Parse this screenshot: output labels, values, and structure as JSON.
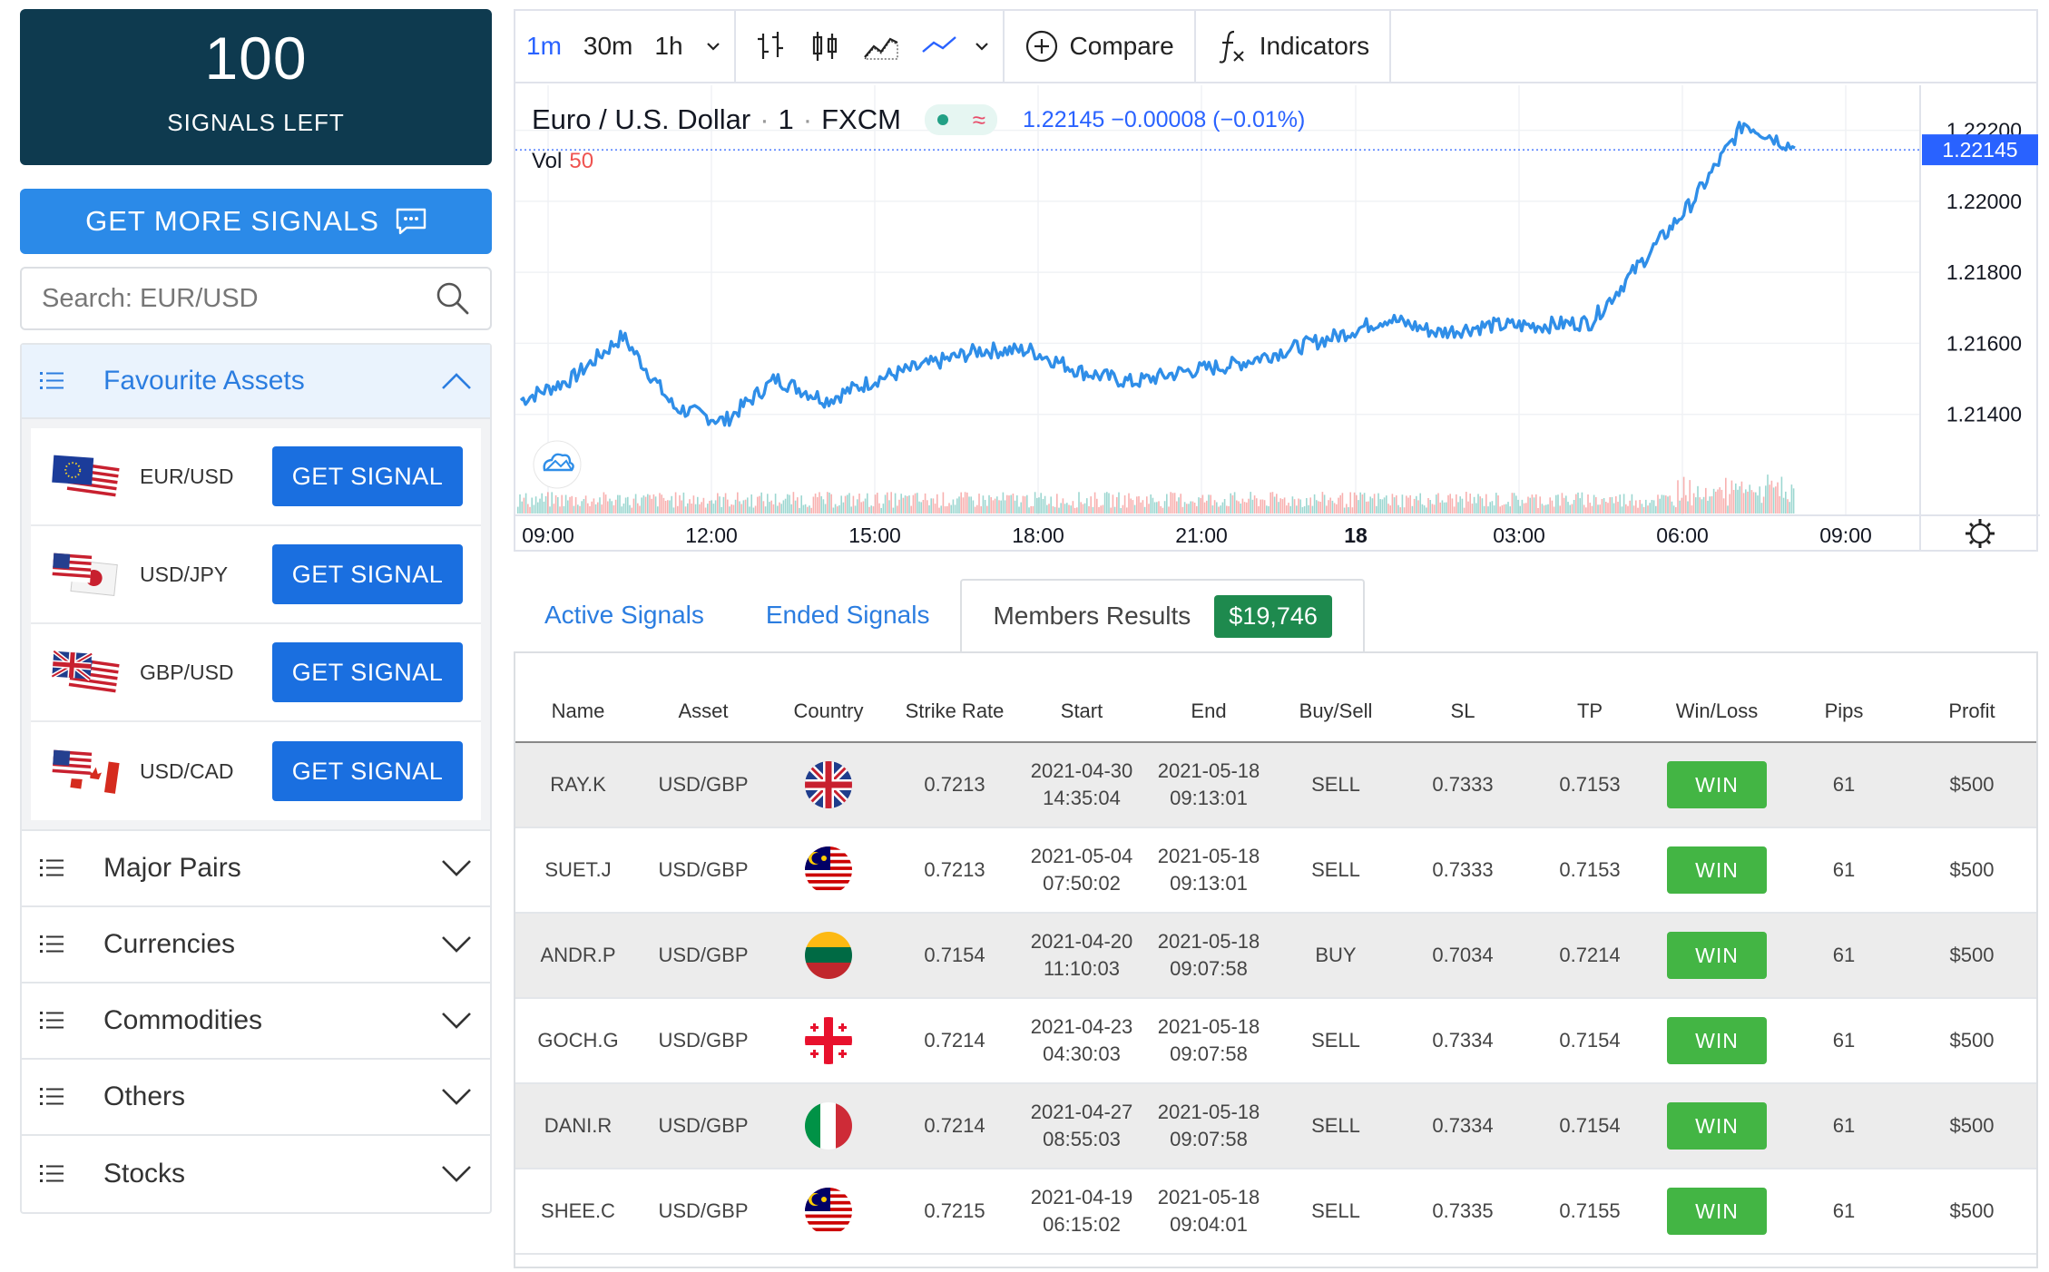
{
  "sidebar": {
    "signals_count": "100",
    "signals_label": "SIGNALS LEFT",
    "more_button": "GET MORE SIGNALS",
    "search_placeholder": "Search: EUR/USD",
    "favourite_title": "Favourite Assets",
    "favourites": [
      {
        "pair": "EUR/USD",
        "button": "GET SIGNAL"
      },
      {
        "pair": "USD/JPY",
        "button": "GET SIGNAL"
      },
      {
        "pair": "GBP/USD",
        "button": "GET SIGNAL"
      },
      {
        "pair": "USD/CAD",
        "button": "GET SIGNAL"
      }
    ],
    "categories": [
      "Major Pairs",
      "Currencies",
      "Commodities",
      "Others",
      "Stocks"
    ]
  },
  "chart": {
    "timeframes": [
      "1m",
      "30m",
      "1h"
    ],
    "active_timeframe": "1m",
    "compare_label": "Compare",
    "indicators_label": "Indicators",
    "symbol": "Euro / U.S. Dollar",
    "interval": "1",
    "exchange": "FXCM",
    "price_info": "1.22145  −0.00008 (−0.01%)",
    "vol_label": "Vol",
    "vol_value": "50",
    "current_price": "1.22145",
    "price_ticks": [
      "1.22200",
      "1.22000",
      "1.21800",
      "1.21600",
      "1.21400"
    ],
    "time_ticks": [
      "09:00",
      "12:00",
      "15:00",
      "18:00",
      "21:00",
      "18",
      "03:00",
      "06:00",
      "09:00"
    ],
    "colors": {
      "line": "#2f8ee8",
      "vol_up": "#26a69a",
      "vol_down": "#ef5350",
      "accent": "#2962ff"
    }
  },
  "chart_data": {
    "type": "line",
    "title": "Euro / U.S. Dollar · 1 · FXCM",
    "x": [
      "09:00",
      "10:00",
      "11:00",
      "12:00",
      "13:00",
      "14:00",
      "15:00",
      "16:00",
      "17:00",
      "18:00",
      "19:00",
      "20:00",
      "21:00",
      "22:00",
      "23:00",
      "00:00",
      "01:00",
      "02:00",
      "03:00",
      "04:00",
      "05:00",
      "06:00",
      "07:00",
      "08:00",
      "09:00",
      "09:30"
    ],
    "series": [
      {
        "values": [
          1.2144,
          1.215,
          1.2162,
          1.2142,
          1.2138,
          1.215,
          1.2144,
          1.215,
          1.2154,
          1.2158,
          1.2158,
          1.2152,
          1.2149,
          1.2152,
          1.2154,
          1.2158,
          1.2162,
          1.2167,
          1.2163,
          1.2165,
          1.2165,
          1.2166,
          1.2183,
          1.22,
          1.2222,
          1.2215
        ]
      }
    ],
    "ylim": [
      1.2132,
      1.2225
    ],
    "xlabel": "",
    "ylabel": ""
  },
  "tabs": {
    "active": "Active Signals",
    "ended": "Ended Signals",
    "members": "Members Results",
    "members_total": "$19,746"
  },
  "table": {
    "headers": [
      "Name",
      "Asset",
      "Country",
      "Strike Rate",
      "Start",
      "End",
      "Buy/Sell",
      "SL",
      "TP",
      "Win/Loss",
      "Pips",
      "Profit"
    ],
    "rows": [
      {
        "name": "RAY.K",
        "asset": "USD/GBP",
        "country": "uk",
        "strike": "0.7213",
        "start_d": "2021-04-30",
        "start_t": "14:35:04",
        "end_d": "2021-05-18",
        "end_t": "09:13:01",
        "side": "SELL",
        "sl": "0.7333",
        "tp": "0.7153",
        "result": "WIN",
        "pips": "61",
        "profit": "$500"
      },
      {
        "name": "SUET.J",
        "asset": "USD/GBP",
        "country": "malaysia",
        "strike": "0.7213",
        "start_d": "2021-05-04",
        "start_t": "07:50:02",
        "end_d": "2021-05-18",
        "end_t": "09:13:01",
        "side": "SELL",
        "sl": "0.7333",
        "tp": "0.7153",
        "result": "WIN",
        "pips": "61",
        "profit": "$500"
      },
      {
        "name": "ANDR.P",
        "asset": "USD/GBP",
        "country": "lithuania",
        "strike": "0.7154",
        "start_d": "2021-04-20",
        "start_t": "11:10:03",
        "end_d": "2021-05-18",
        "end_t": "09:07:58",
        "side": "BUY",
        "sl": "0.7034",
        "tp": "0.7214",
        "result": "WIN",
        "pips": "61",
        "profit": "$500"
      },
      {
        "name": "GOCH.G",
        "asset": "USD/GBP",
        "country": "georgia",
        "strike": "0.7214",
        "start_d": "2021-04-23",
        "start_t": "04:30:03",
        "end_d": "2021-05-18",
        "end_t": "09:07:58",
        "side": "SELL",
        "sl": "0.7334",
        "tp": "0.7154",
        "result": "WIN",
        "pips": "61",
        "profit": "$500"
      },
      {
        "name": "DANI.R",
        "asset": "USD/GBP",
        "country": "italy",
        "strike": "0.7214",
        "start_d": "2021-04-27",
        "start_t": "08:55:03",
        "end_d": "2021-05-18",
        "end_t": "09:07:58",
        "side": "SELL",
        "sl": "0.7334",
        "tp": "0.7154",
        "result": "WIN",
        "pips": "61",
        "profit": "$500"
      },
      {
        "name": "SHEE.C",
        "asset": "USD/GBP",
        "country": "malaysia",
        "strike": "0.7215",
        "start_d": "2021-04-19",
        "start_t": "06:15:02",
        "end_d": "2021-05-18",
        "end_t": "09:04:01",
        "side": "SELL",
        "sl": "0.7335",
        "tp": "0.7155",
        "result": "WIN",
        "pips": "61",
        "profit": "$500"
      }
    ]
  }
}
